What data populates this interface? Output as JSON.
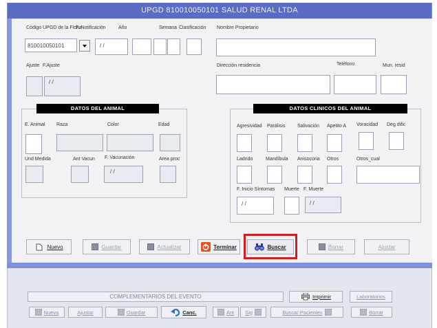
{
  "window": {
    "title": "UPGD 810010050101 SALUD RENAL LTDA"
  },
  "header_fields": {
    "codigo_label": "Código UPGD de la Ficha",
    "codigo_value": "810010050101",
    "notificacion_label": "F. Notificación",
    "notificacion_value": "/ /",
    "anio_label": "Año",
    "semana_label": "Semana",
    "clasificacion_label": "Clasificación",
    "propietario_label": "Nombre Propietario",
    "ajuste_label": "Ajuste",
    "f_ajuste_label": "F.Ajuste",
    "f_ajuste_value": "/ /",
    "direccion_label": "Dirección residencia",
    "telefono_label": "Teléfono",
    "mun_label": "Mun. resid"
  },
  "animal": {
    "title": "DATOS DEL ANIMAL",
    "e_animal_label": "E. Animal",
    "raza_label": "Raza",
    "color_label": "Color",
    "edad_label": "Edad",
    "und_medida_label": "Und Medida",
    "ant_vacun_label": "Ant Vacun",
    "f_vacunacion_label": "F. Vacunación",
    "f_vacunacion_value": "/ /",
    "area_proc_label": "Area proc"
  },
  "clinicos": {
    "title": "DATOS CLINICOS DEL ANIMAL",
    "agresividad_label": "Agresividad",
    "paralisis_label": "Parálisis",
    "salivacion_label": "Salivación",
    "apetito_label": "Apetito A",
    "voracidad_label": "Voracidad",
    "deg_dific_label": "Deg dific",
    "ladrido_label": "Ladrido",
    "mandibula_label": "Mandíbula",
    "anisocoria_label": "Anisocoria",
    "otros_label": "Otros",
    "otros_cual_label": "Otros_cual",
    "f_inicio_label": "F. Inicio Síntomas",
    "f_inicio_value": "/ /",
    "muerte_label": "Muerte",
    "f_muerte_label": "F. Muerte",
    "f_muerte_value": "/ /"
  },
  "toolbar": {
    "nuevo": "Nuevo",
    "guardar": "Guardar",
    "actualizar": "Actualizar",
    "terminar": "Terminar",
    "buscar": "Buscar",
    "borrar": "Borrar",
    "ajustar": "Ajustar"
  },
  "lower": {
    "complementarios": "COMPLEMENTARIOS DEL EVENTO",
    "imprimir": "Imprimir",
    "laboratorios": "Laboratorios",
    "nueva": "Nueva",
    "ajustar": "Ajustar",
    "guardar": "Guardar",
    "canc": "Canc.",
    "ant": "Ant",
    "sig": "Sig",
    "buscar_pacientes": "Buscar Pacientes",
    "borrar": "Borrar"
  },
  "colors": {
    "title_bar": "#5a6cc3",
    "highlight": "#cc1f1f",
    "terminar_icon": "#e2531e",
    "canc_icon": "#2d6fcf"
  }
}
